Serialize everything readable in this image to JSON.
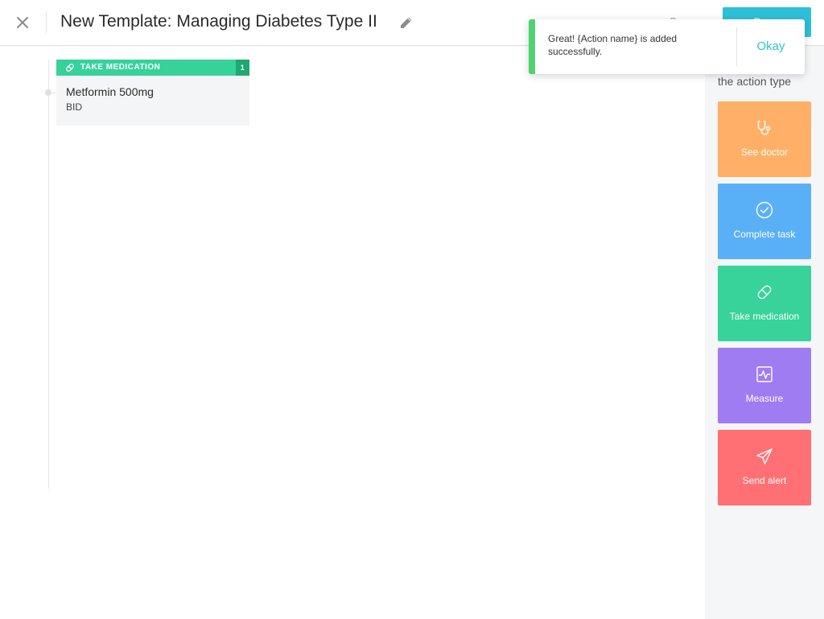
{
  "header": {
    "title": "New Template: Managing Diabetes Type II",
    "close_icon": "close-icon",
    "edit_icon": "pencil-icon",
    "save_label": "Save",
    "primary_label": "Done"
  },
  "timeline": {
    "cards": [
      {
        "type_label": "TAKE MEDICATION",
        "type_icon": "pill-icon",
        "count": "1",
        "medication": "Metformin 500mg",
        "frequency": "BID",
        "color": "#37d19a"
      }
    ]
  },
  "sidebar": {
    "title": "the action type",
    "actions": [
      {
        "label": "See doctor",
        "icon": "stethoscope-icon",
        "color": "#ffb066"
      },
      {
        "label": "Complete task",
        "icon": "check-circle-icon",
        "color": "#5ab0f7"
      },
      {
        "label": "Take medication",
        "icon": "pill-icon",
        "color": "#37d39a"
      },
      {
        "label": "Measure",
        "icon": "chart-icon",
        "color": "#a07cf3"
      },
      {
        "label": "Send alert",
        "icon": "paper-plane-icon",
        "color": "#ff7074"
      }
    ]
  },
  "toast": {
    "message": "Great! {Action name} is added successfully.",
    "action_label": "Okay",
    "accent_color": "#4fd36e"
  }
}
